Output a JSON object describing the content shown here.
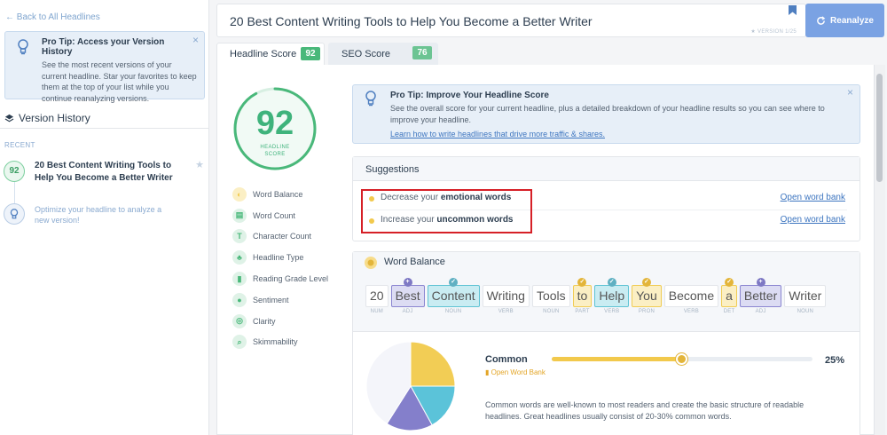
{
  "sidebar": {
    "back_link": "← Back to All Headlines",
    "tip": {
      "title": "Pro Tip: Access your Version History",
      "text": "See the most recent versions of your current headline. Star your favorites to keep them at the top of your list while you continue reanalyzing versions."
    },
    "version_history_title": "Version History",
    "recent_label": "RECENT",
    "history": [
      {
        "score": "92",
        "headline": "20 Best Content Writing Tools to Help You Become a Better Writer"
      }
    ],
    "optimize_text": "Optimize your headline to analyze a new version!"
  },
  "header": {
    "headline": "20 Best Content Writing Tools to Help You Become a Better Writer",
    "version": "VERSION 1/25",
    "reanalyze_label": "Reanalyze"
  },
  "tabs": [
    {
      "label": "Headline Score",
      "badge": "92"
    },
    {
      "label": "SEO Score",
      "badge": "76"
    }
  ],
  "score": {
    "value": "92",
    "label": "HEADLINE SCORE",
    "percent": 92
  },
  "nav": [
    {
      "label": "Word Balance",
      "icon": "word-balance-icon",
      "color": "#f2c94c"
    },
    {
      "label": "Word Count",
      "icon": "word-count-icon",
      "color": "#49b87a"
    },
    {
      "label": "Character Count",
      "icon": "character-count-icon",
      "color": "#49b87a"
    },
    {
      "label": "Headline Type",
      "icon": "headline-type-icon",
      "color": "#49b87a"
    },
    {
      "label": "Reading Grade Level",
      "icon": "reading-grade-icon",
      "color": "#49b87a"
    },
    {
      "label": "Sentiment",
      "icon": "sentiment-icon",
      "color": "#49b87a"
    },
    {
      "label": "Clarity",
      "icon": "clarity-icon",
      "color": "#49b87a"
    },
    {
      "label": "Skimmability",
      "icon": "skimmability-icon",
      "color": "#49b87a"
    }
  ],
  "main_tip": {
    "title": "Pro Tip: Improve Your Headline Score",
    "text": "See the overall score for your current headline, plus a detailed breakdown of your headline results so you can see where to improve your headline.",
    "link": "Learn how to write headlines that drive more traffic & shares."
  },
  "suggestions": {
    "title": "Suggestions",
    "items": [
      {
        "prefix": "Decrease your ",
        "bold": "emotional words",
        "link": "Open word bank"
      },
      {
        "prefix": "Increase your ",
        "bold": "uncommon words",
        "link": "Open word bank"
      }
    ]
  },
  "word_balance": {
    "title": "Word Balance",
    "words": [
      {
        "word": "20",
        "pos": "NUM",
        "type": "none"
      },
      {
        "word": "Best",
        "pos": "ADJ",
        "type": "purple"
      },
      {
        "word": "Content",
        "pos": "NOUN",
        "type": "teal"
      },
      {
        "word": "Writing",
        "pos": "VERB",
        "type": "none"
      },
      {
        "word": "Tools",
        "pos": "NOUN",
        "type": "none"
      },
      {
        "word": "to",
        "pos": "PART",
        "type": "yellow"
      },
      {
        "word": "Help",
        "pos": "VERB",
        "type": "teal"
      },
      {
        "word": "You",
        "pos": "PRON",
        "type": "yellow"
      },
      {
        "word": "Become",
        "pos": "VERB",
        "type": "none"
      },
      {
        "word": "a",
        "pos": "DET",
        "type": "yellow"
      },
      {
        "word": "Better",
        "pos": "ADJ",
        "type": "purple"
      },
      {
        "word": "Writer",
        "pos": "NOUN",
        "type": "none"
      }
    ],
    "common": {
      "label": "Common",
      "open_bank": "Open Word Bank",
      "percent_text": "25%",
      "percent": 25,
      "description": "Common words are well-known to most readers and create the basic structure of readable headlines. Great headlines usually consist of 20-30% common words."
    },
    "pie_colors": {
      "common": "#f2cd55",
      "uncommon": "#5bc3d9",
      "emotional": "#847fcb",
      "other": "#f4f5fa"
    }
  }
}
